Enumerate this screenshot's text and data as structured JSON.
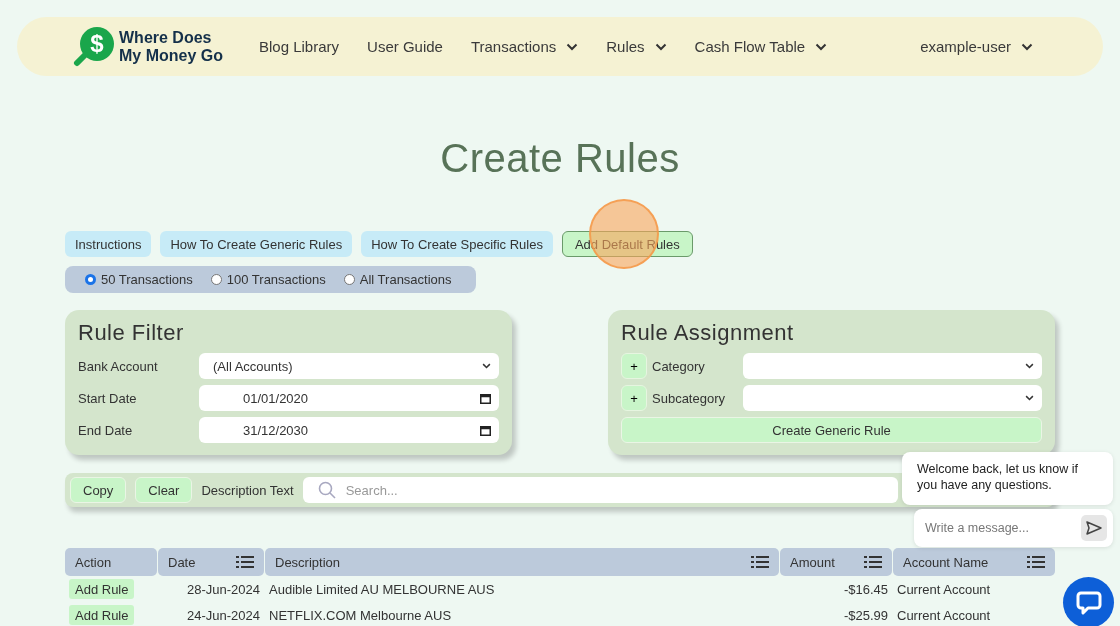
{
  "nav": {
    "logo_symbol": "$",
    "brand": "Where Does My Money Go",
    "items": [
      {
        "label": "Blog Library",
        "dropdown": false
      },
      {
        "label": "User Guide",
        "dropdown": false
      },
      {
        "label": "Transactions",
        "dropdown": true
      },
      {
        "label": "Rules",
        "dropdown": true
      },
      {
        "label": "Cash Flow Table",
        "dropdown": true
      }
    ],
    "user": {
      "label": "example-user",
      "dropdown": true
    }
  },
  "title": "Create Rules",
  "help_buttons": [
    {
      "label": "Instructions",
      "kind": "info"
    },
    {
      "label": "How To Create Generic Rules",
      "kind": "info"
    },
    {
      "label": "How To Create Specific Rules",
      "kind": "info"
    },
    {
      "label": "Add Default Rules",
      "kind": "action"
    }
  ],
  "transaction_limits": [
    {
      "label": "50 Transactions",
      "selected": true
    },
    {
      "label": "100 Transactions",
      "selected": false
    },
    {
      "label": "All Transactions",
      "selected": false
    }
  ],
  "rule_filter": {
    "title": "Rule Filter",
    "fields": [
      {
        "label": "Bank Account",
        "kind": "select",
        "value": "(All Accounts)"
      },
      {
        "label": "Start Date",
        "kind": "date",
        "value": "01/01/2020"
      },
      {
        "label": "End Date",
        "kind": "date",
        "value": "31/12/2030"
      }
    ]
  },
  "rule_assignment": {
    "title": "Rule Assignment",
    "fields": [
      {
        "label": "Category",
        "add": "+"
      },
      {
        "label": "Subcategory",
        "add": "+"
      }
    ],
    "button": "Create Generic Rule"
  },
  "search_bar": {
    "copy": "Copy",
    "clear": "Clear",
    "label": "Description Text",
    "placeholder": "Search..."
  },
  "table": {
    "columns": [
      {
        "label": "Action",
        "filter": false
      },
      {
        "label": "Date",
        "filter": true
      },
      {
        "label": "Description",
        "filter": true
      },
      {
        "label": "Amount",
        "filter": true
      },
      {
        "label": "Account Name",
        "filter": true
      }
    ],
    "rows": [
      {
        "action": "Add Rule",
        "date": "28-Jun-2024",
        "description": "Audible Limited AU MELBOURNE AUS",
        "amount": "-$16.45",
        "account": "Current Account"
      },
      {
        "action": "Add Rule",
        "date": "24-Jun-2024",
        "description": "NETFLIX.COM Melbourne AUS",
        "amount": "-$25.99",
        "account": "Current Account"
      }
    ]
  },
  "chat": {
    "message": "Welcome back, let us know if you have any questions.",
    "placeholder": "Write a message..."
  }
}
